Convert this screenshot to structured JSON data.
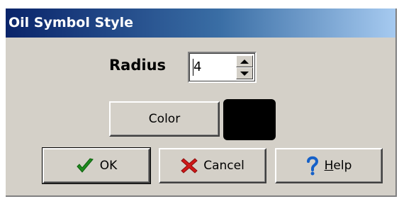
{
  "window": {
    "title": "Oil Symbol Style"
  },
  "radius": {
    "label": "Radius",
    "value": "4"
  },
  "color": {
    "button_label": "Color",
    "swatch_color": "#000000"
  },
  "buttons": {
    "ok": {
      "label": "OK",
      "icon": "checkmark-icon"
    },
    "cancel": {
      "label": "Cancel",
      "icon": "x-icon"
    },
    "help": {
      "label_accel": "H",
      "label_rest": "elp",
      "icon": "question-icon"
    }
  },
  "colors": {
    "title_bar": "#0a246a",
    "dialog_bg": "#d4d0c8",
    "ok_icon": "#1e8a1e",
    "cancel_icon": "#d01818",
    "help_icon": "#1560c8"
  }
}
